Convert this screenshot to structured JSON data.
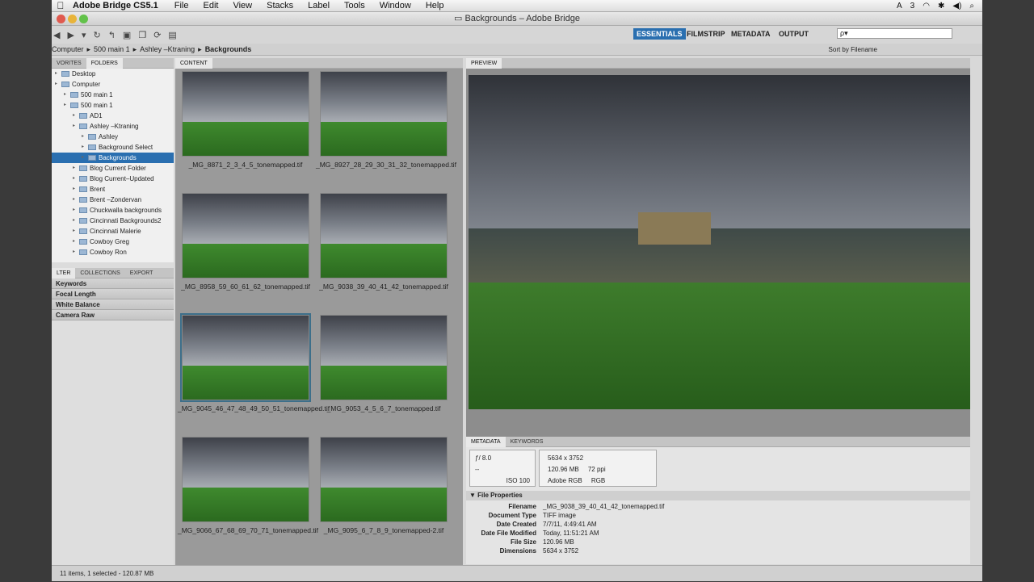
{
  "menubar": {
    "app": "Adobe Bridge CS5.1",
    "items": [
      "File",
      "Edit",
      "View",
      "Stacks",
      "Label",
      "Tools",
      "Window",
      "Help"
    ],
    "status_num": "3"
  },
  "window": {
    "title": "Backgrounds – Adobe Bridge"
  },
  "workspaces": [
    "ESSENTIALS",
    "FILMSTRIP",
    "METADATA",
    "OUTPUT"
  ],
  "search": {
    "placeholder": "ρ▾"
  },
  "path": [
    "Computer",
    "500 main 1",
    "Ashley –Ktraning",
    "Backgrounds"
  ],
  "sort": {
    "label": "Sort by Filename"
  },
  "left_tabs": [
    "VORITES",
    "FOLDERS"
  ],
  "folders": [
    {
      "label": "Desktop",
      "indent": 0
    },
    {
      "label": "Computer",
      "indent": 0
    },
    {
      "label": "500 main 1",
      "indent": 1
    },
    {
      "label": "500 main 1",
      "indent": 1
    },
    {
      "label": "AD1",
      "indent": 2
    },
    {
      "label": "Ashley –Ktraning",
      "indent": 2
    },
    {
      "label": "Ashley",
      "indent": 3
    },
    {
      "label": "Background Select",
      "indent": 3
    },
    {
      "label": "Backgrounds",
      "indent": 3
    },
    {
      "label": "Blog Current Folder",
      "indent": 2
    },
    {
      "label": "Blog Current–Updated",
      "indent": 2
    },
    {
      "label": "Brent",
      "indent": 2
    },
    {
      "label": "Brent –Zondervan",
      "indent": 2
    },
    {
      "label": "Chuckwalla backgrounds",
      "indent": 2
    },
    {
      "label": "Cincinnati Backgrounds2",
      "indent": 2
    },
    {
      "label": "Cincinnati Malerie",
      "indent": 2
    },
    {
      "label": "Cowboy Greg",
      "indent": 2
    },
    {
      "label": "Cowboy Ron",
      "indent": 2
    }
  ],
  "filter_tabs": [
    "LTER",
    "COLLECTIONS",
    "EXPORT"
  ],
  "filters": [
    "Keywords",
    "Focal Length",
    "White Balance",
    "Camera Raw"
  ],
  "content": {
    "tab": "CONTENT",
    "thumbs": [
      "_MG_8871_2_3_4_5_tonemapped.tif",
      "_MG_8927_28_29_30_31_32_tonemapped.tif",
      "_MG_8958_59_60_61_62_tonemapped.tif",
      "_MG_9038_39_40_41_42_tonemapped.tif",
      "_MG_9045_46_47_48_49_50_51_tonemapped.tif",
      "_MG_9053_4_5_6_7_tonemapped.tif",
      "_MG_9066_67_68_69_70_71_tonemapped.tif",
      "_MG_9095_6_7_8_9_tonemapped-2.tif"
    ]
  },
  "preview": {
    "tab": "PREVIEW"
  },
  "metadata": {
    "tabs": [
      "METADATA",
      "KEYWORDS"
    ],
    "aperture": "ƒ/ 8.0",
    "iso": "ISO 100",
    "dash": "--",
    "dims": "5634 x 3752",
    "size": "120.96 MB",
    "ppi": "72 ppi",
    "profile": "Adobe RGB",
    "mode": "RGB",
    "section": "File Properties",
    "fields": [
      {
        "k": "Filename",
        "v": "_MG_9038_39_40_41_42_tonemapped.tif"
      },
      {
        "k": "Document Type",
        "v": "TIFF image"
      },
      {
        "k": "Date Created",
        "v": "7/7/11, 4:49:41 AM"
      },
      {
        "k": "Date File Modified",
        "v": "Today, 11:51:21 AM"
      },
      {
        "k": "File Size",
        "v": "120.96 MB"
      },
      {
        "k": "Dimensions",
        "v": "5634 x 3752"
      }
    ]
  },
  "status": {
    "text": "11 items, 1 selected - 120.87 MB"
  }
}
